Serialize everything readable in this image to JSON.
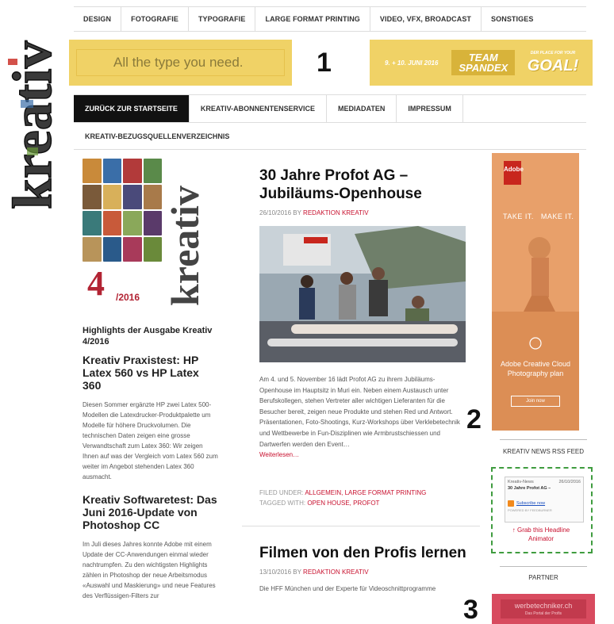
{
  "logo": {
    "text": "kreativ"
  },
  "top_nav": [
    {
      "label": "DESIGN"
    },
    {
      "label": "FOTOGRAFIE"
    },
    {
      "label": "TYPOGRAFIE"
    },
    {
      "label": "LARGE FORMAT PRINTING"
    },
    {
      "label": "VIDEO, VFX, BROADCAST"
    },
    {
      "label": "SONSTIGES"
    }
  ],
  "banner1": {
    "text": "All the type you need."
  },
  "banner2": {
    "date": "9. + 10. JUNI 2016",
    "team": "TEAM SPANDEX",
    "tagline": "DER PLACE FOR YOUR",
    "goal": "GOAL!"
  },
  "annotations": {
    "n1": "1",
    "n2": "2",
    "n3": "3"
  },
  "sub_nav": {
    "row1": [
      {
        "label": "ZURÜCK ZUR STARTSEITE"
      },
      {
        "label": "KREATIV-ABONNENTENSERVICE"
      },
      {
        "label": "MEDIADATEN"
      },
      {
        "label": "IMPRESSUM"
      }
    ],
    "row2": [
      {
        "label": "KREATIV-BEZUGSQUELLENVERZEICHNIS"
      }
    ]
  },
  "sidebar_left": {
    "cover_issue": "4",
    "cover_year": "/2016",
    "highlights": "Highlights der Ausgabe Kreativ 4/2016",
    "article1_title": "Kreativ Praxistest: HP Latex 560 vs HP Latex 360",
    "article1_text": "Diesen Sommer ergänzte HP zwei Latex 500-Modellen die Latexdrucker-Produktpalette um Modelle für höhere Druckvolumen. Die technischen Daten zeigen eine grosse Verwandtschaft zum Latex 360: Wir zeigen Ihnen auf was der Vergleich vom Latex 560 zum weiter im Angebot stehenden Latex 360 ausmacht.",
    "article2_title": "Kreativ Softwaretest: Das Juni 2016-Update von Photoshop CC",
    "article2_text": "Im Juli dieses Jahres konnte Adobe mit einem Update der CC-Anwendungen einmal wieder nachtrumpfen. Zu den wichtigsten Highlights zählen in Photoshop der neue Arbeitsmodus «Auswahl und Maskierung» und neue Features des Verflüssigen-Filters zur"
  },
  "post1": {
    "title": "30 Jahre Profot AG – Jubiläums-Openhouse",
    "date": "26/10/2016",
    "by": "BY",
    "author": "REDAKTION KREATIV",
    "excerpt": "Am 4. und 5. November 16 lädt Profot AG zu ihrem Jubiläums-Openhouse im Hauptsitz in Muri ein. Neben einem Austausch unter Berufskollegen, stehen Vertreter aller wichtigen Lieferanten für die Besucher bereit, zeigen neue Produkte und stehen Red und Antwort. Präsentationen, Foto-Shootings, Kurz-Workshops über Verklebetechnik und Wettbewerbe in Fun-Disziplinen wie Armbrustschiessen und Dartwerfen werden den Event…",
    "more": "Weiterlesen…",
    "filed_label": "FILED UNDER:",
    "filed": "ALLGEMEIN, LARGE FORMAT PRINTING",
    "tagged_label": "TAGGED WITH:",
    "tagged": "OPEN HOUSE, PROFOT"
  },
  "post2": {
    "title": "Filmen von den Profis lernen",
    "date": "13/10/2016",
    "by": "BY",
    "author": "REDAKTION KREATIV",
    "excerpt": "Die HFF München und der Experte für Videoschnittprogramme"
  },
  "ad_adobe": {
    "brand": "Adobe",
    "take": "TAKE IT.",
    "make": "MAKE IT.",
    "product": "Adobe Creative Cloud Photography plan",
    "cta": "Join now"
  },
  "rss": {
    "heading": "KREATIV NEWS RSS FEED",
    "source": "Kreativ-News",
    "date": "26/10/2016",
    "item": "30 Jahre Profot AG –",
    "subscribe": "Subscribe now",
    "powered": "POWERED BY FEEDBURNER",
    "grab": "↑ Grab this Headline Animator"
  },
  "partner": {
    "heading": "PARTNER",
    "ad_text": "werbetechniker.ch",
    "ad_sub": "Das Portal der Profis"
  },
  "colors": {
    "accent_red": "#c8102e",
    "banner_yellow": "#f0d266",
    "adobe_orange": "#e8a06a",
    "rss_dashed_green": "#3f9c3f"
  }
}
